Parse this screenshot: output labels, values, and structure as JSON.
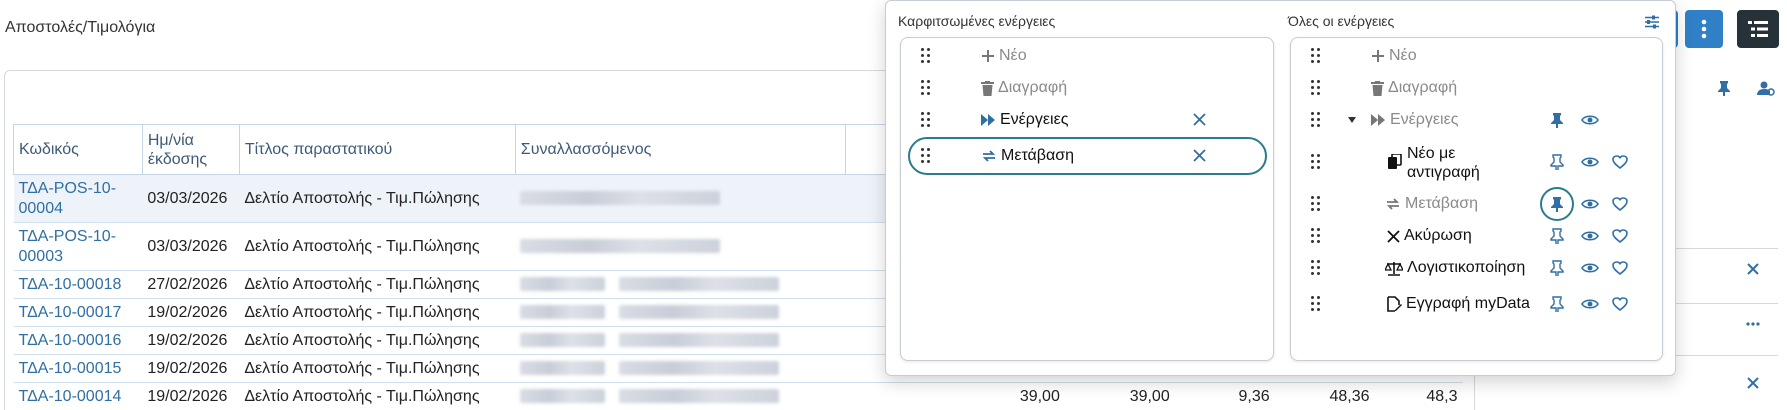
{
  "page": {
    "title": "Αποστολές/Τιμολόγια"
  },
  "table": {
    "columns": [
      "Κωδικός",
      "Ημ/νία έκδοσης",
      "Τίτλος παραστατικού",
      "Συναλλασσόμενος"
    ],
    "rows": [
      {
        "code": "ΤΔΑ-POS-10-00004",
        "date": "03/03/2026",
        "title": "Δελτίο Αποστολής - Τιμ.Πώλησης",
        "selected": true
      },
      {
        "code": "ΤΔΑ-POS-10-00003",
        "date": "03/03/2026",
        "title": "Δελτίο Αποστολής - Τιμ.Πώλησης"
      },
      {
        "code": "ΤΔΑ-10-00018",
        "date": "27/02/2026",
        "title": "Δελτίο Αποστολής - Τιμ.Πώλησης"
      },
      {
        "code": "ΤΔΑ-10-00017",
        "date": "19/02/2026",
        "title": "Δελτίο Αποστολής - Τιμ.Πώλησης"
      },
      {
        "code": "ΤΔΑ-10-00016",
        "date": "19/02/2026",
        "title": "Δελτίο Αποστολής - Τιμ.Πώλησης"
      },
      {
        "code": "ΤΔΑ-10-00015",
        "date": "19/02/2026",
        "title": "Δελτίο Αποστολής - Τιμ.Πώλησης"
      },
      {
        "code": "ΤΔΑ-10-00014",
        "date": "19/02/2026",
        "title": "Δελτίο Αποστολής - Τιμ.Πώλησης",
        "v1": "39,00",
        "v2": "39,00",
        "v3": "9,36",
        "v4": "48,36",
        "v5": "48,3"
      }
    ]
  },
  "popup": {
    "pinned_title": "Καρφιτσωμένες ενέργειες",
    "all_title": "Όλες οι ενέργειες",
    "pinned": [
      {
        "label": "Νέο",
        "icon": "plus-icon",
        "state": "muted",
        "removable": false
      },
      {
        "label": "Διαγραφή",
        "icon": "trash-icon",
        "state": "muted",
        "removable": false
      },
      {
        "label": "Ενέργειες",
        "icon": "fast-forward-icon",
        "state": "active",
        "removable": true
      },
      {
        "label": "Μετάβαση",
        "icon": "transfer-icon",
        "state": "active",
        "removable": true,
        "highlighted": true
      }
    ],
    "all": [
      {
        "label": "Νέο",
        "icon": "plus-icon"
      },
      {
        "label": "Διαγραφή",
        "icon": "trash-icon"
      },
      {
        "label": "Ενέργειες",
        "icon": "fast-forward-icon",
        "expanded": true
      },
      {
        "label": "Νέο με αντιγραφή",
        "icon": "copy-icon"
      },
      {
        "label": "Μετάβαση",
        "icon": "transfer-icon",
        "pinned": true
      },
      {
        "label": "Ακύρωση",
        "icon": "x-icon"
      },
      {
        "label": "Λογιστικοποίηση",
        "icon": "scales-icon"
      },
      {
        "label": "Εγγραφή myData",
        "icon": "file-sign-icon"
      }
    ]
  },
  "colors": {
    "accent": "#2f6fa5",
    "highlight": "#2a7b8c",
    "dark_button": "#263238",
    "primary_button": "#2f80c7"
  }
}
